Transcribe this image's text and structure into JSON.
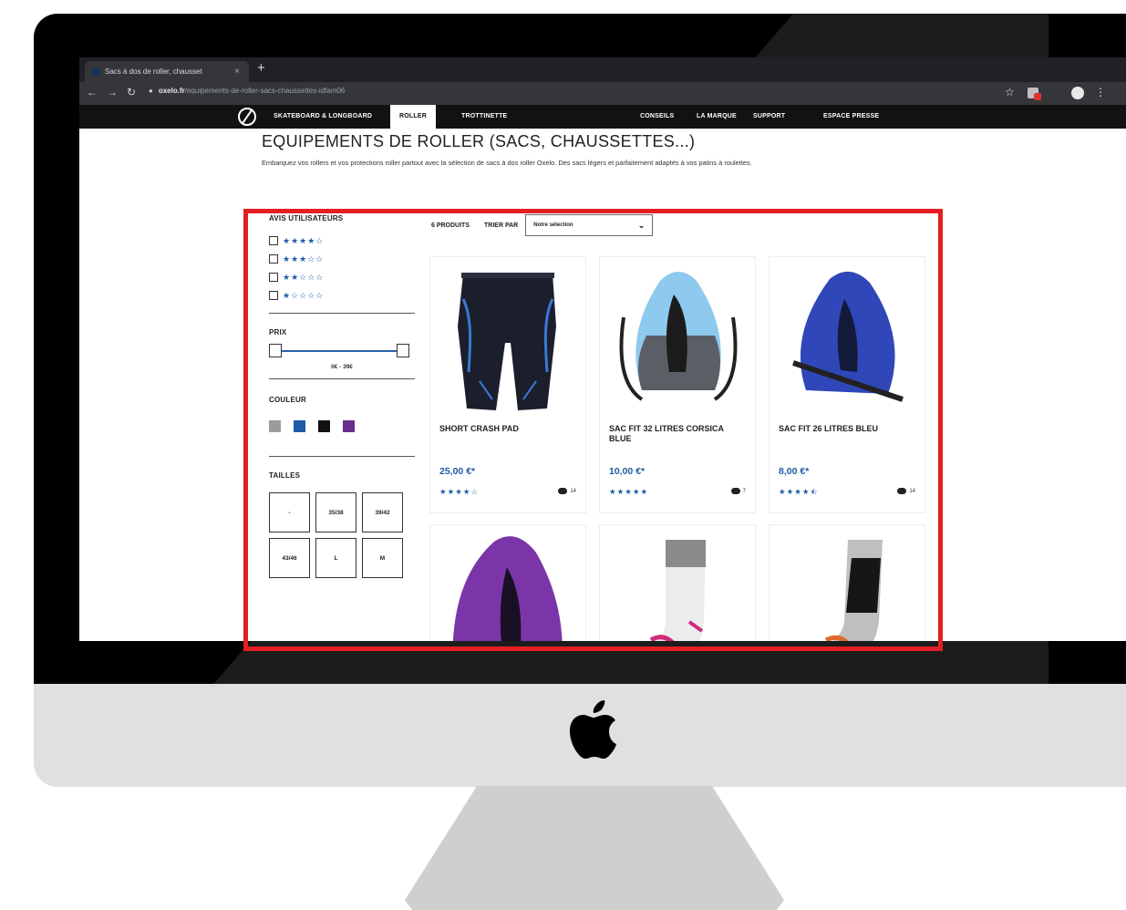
{
  "browser": {
    "tab_title": "Sacs à dos de roller, chausset",
    "tab_close": "×",
    "new_tab": "+",
    "url_domain": "oxelo.fr",
    "url_path": "/equipements-de-roller-sacs-chaussettes-idfam06"
  },
  "site_nav": {
    "items": [
      {
        "label": "SKATEBOARD & LONGBOARD"
      },
      {
        "label": "ROLLER"
      },
      {
        "label": "TROTTINETTE"
      },
      {
        "label": "CONSEILS"
      },
      {
        "label": "LA MARQUE"
      },
      {
        "label": "SUPPORT"
      },
      {
        "label": "ESPACE PRESSE"
      }
    ],
    "active": "ROLLER"
  },
  "page": {
    "title": "EQUIPEMENTS DE ROLLER (SACS, CHAUSSETTES...)",
    "intro": "Embarquez vos rollers et vos protections roller partout avec la sélection de sacs à dos roller Oxelo. Des sacs légers et parfaitement adaptés à vos patins à roulettes."
  },
  "filters": {
    "ratings_title": "AVIS UTILISATEURS",
    "ratings": [
      {
        "stars": "★★★★☆"
      },
      {
        "stars": "★★★☆☆"
      },
      {
        "stars": "★★☆☆☆"
      },
      {
        "stars": "★☆☆☆☆"
      }
    ],
    "price_title": "PRIX",
    "price_range": "0€ - 39€",
    "color_title": "COULEUR",
    "colors": [
      "#9c9c9c",
      "#1f5aa6",
      "#111111",
      "#6a2e8c"
    ],
    "sizes_title": "TAILLES",
    "sizes": [
      "-",
      "35/38",
      "39/42",
      "43/46",
      "L",
      "M"
    ]
  },
  "listing": {
    "count": "6 PRODUITS",
    "sort_label": "TRIER PAR",
    "sort_value": "Notre sélection",
    "products": [
      {
        "name": "SHORT CRASH PAD",
        "price": "25,00 €*",
        "stars": "★★★★☆",
        "reviews": "14"
      },
      {
        "name": "SAC FIT 32 LITRES CORSICA BLUE",
        "price": "10,00 €*",
        "stars": "★★★★★",
        "reviews": "7"
      },
      {
        "name": "SAC FIT 26 LITRES BLEU",
        "price": "8,00 €*",
        "stars": "★★★★⯪",
        "reviews": "14"
      },
      {
        "name": "",
        "price": "",
        "stars": "",
        "reviews": ""
      },
      {
        "name": "",
        "price": "",
        "stars": "",
        "reviews": ""
      },
      {
        "name": "",
        "price": "",
        "stars": "",
        "reviews": ""
      }
    ]
  },
  "colors": {
    "accent_blue": "#1f5aa6",
    "highlight_red": "#e31e24"
  }
}
